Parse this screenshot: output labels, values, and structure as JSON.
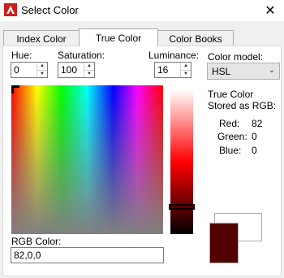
{
  "window": {
    "title": "Select Color",
    "close_glyph": "✕"
  },
  "tabs": [
    "Index Color",
    "True Color",
    "Color Books"
  ],
  "hue": {
    "label": "Hue:",
    "value": "0"
  },
  "saturation": {
    "label": "Saturation:",
    "value": "100"
  },
  "luminance": {
    "label": "Luminance:",
    "value": "16"
  },
  "color_model": {
    "label": "Color model:",
    "value": "HSL"
  },
  "stored": {
    "heading": "True Color Stored as RGB:",
    "red_label": "Red:",
    "red": "82",
    "green_label": "Green:",
    "green": "0",
    "blue_label": "Blue:",
    "blue": "0"
  },
  "rgb_color": {
    "label": "RGB Color:",
    "value": "82,0,0"
  },
  "swatch": {
    "current_color": "#520000",
    "new_color": "#ffffff"
  },
  "colors": {
    "accent": "#cc1f1f"
  }
}
